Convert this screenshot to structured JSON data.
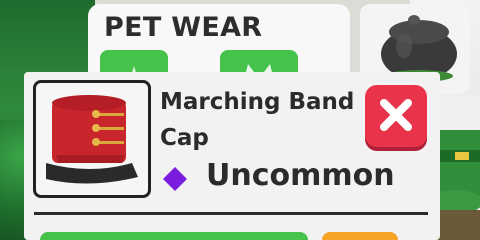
{
  "panel": {
    "title": "PET WEAR",
    "tabs": [
      {
        "icon": "pet-tab-icon"
      },
      {
        "icon": "cat-tab-icon"
      }
    ]
  },
  "tooltip": {
    "item_name": "Marching Band Cap",
    "rarity": "Uncommon",
    "rarity_icon": "diamond-icon",
    "rarity_color": "#7a1dde",
    "close_icon": "close-icon"
  },
  "colors": {
    "green_button": "#45c24a",
    "orange_button": "#f6a224",
    "close_red": "#e8334a"
  }
}
